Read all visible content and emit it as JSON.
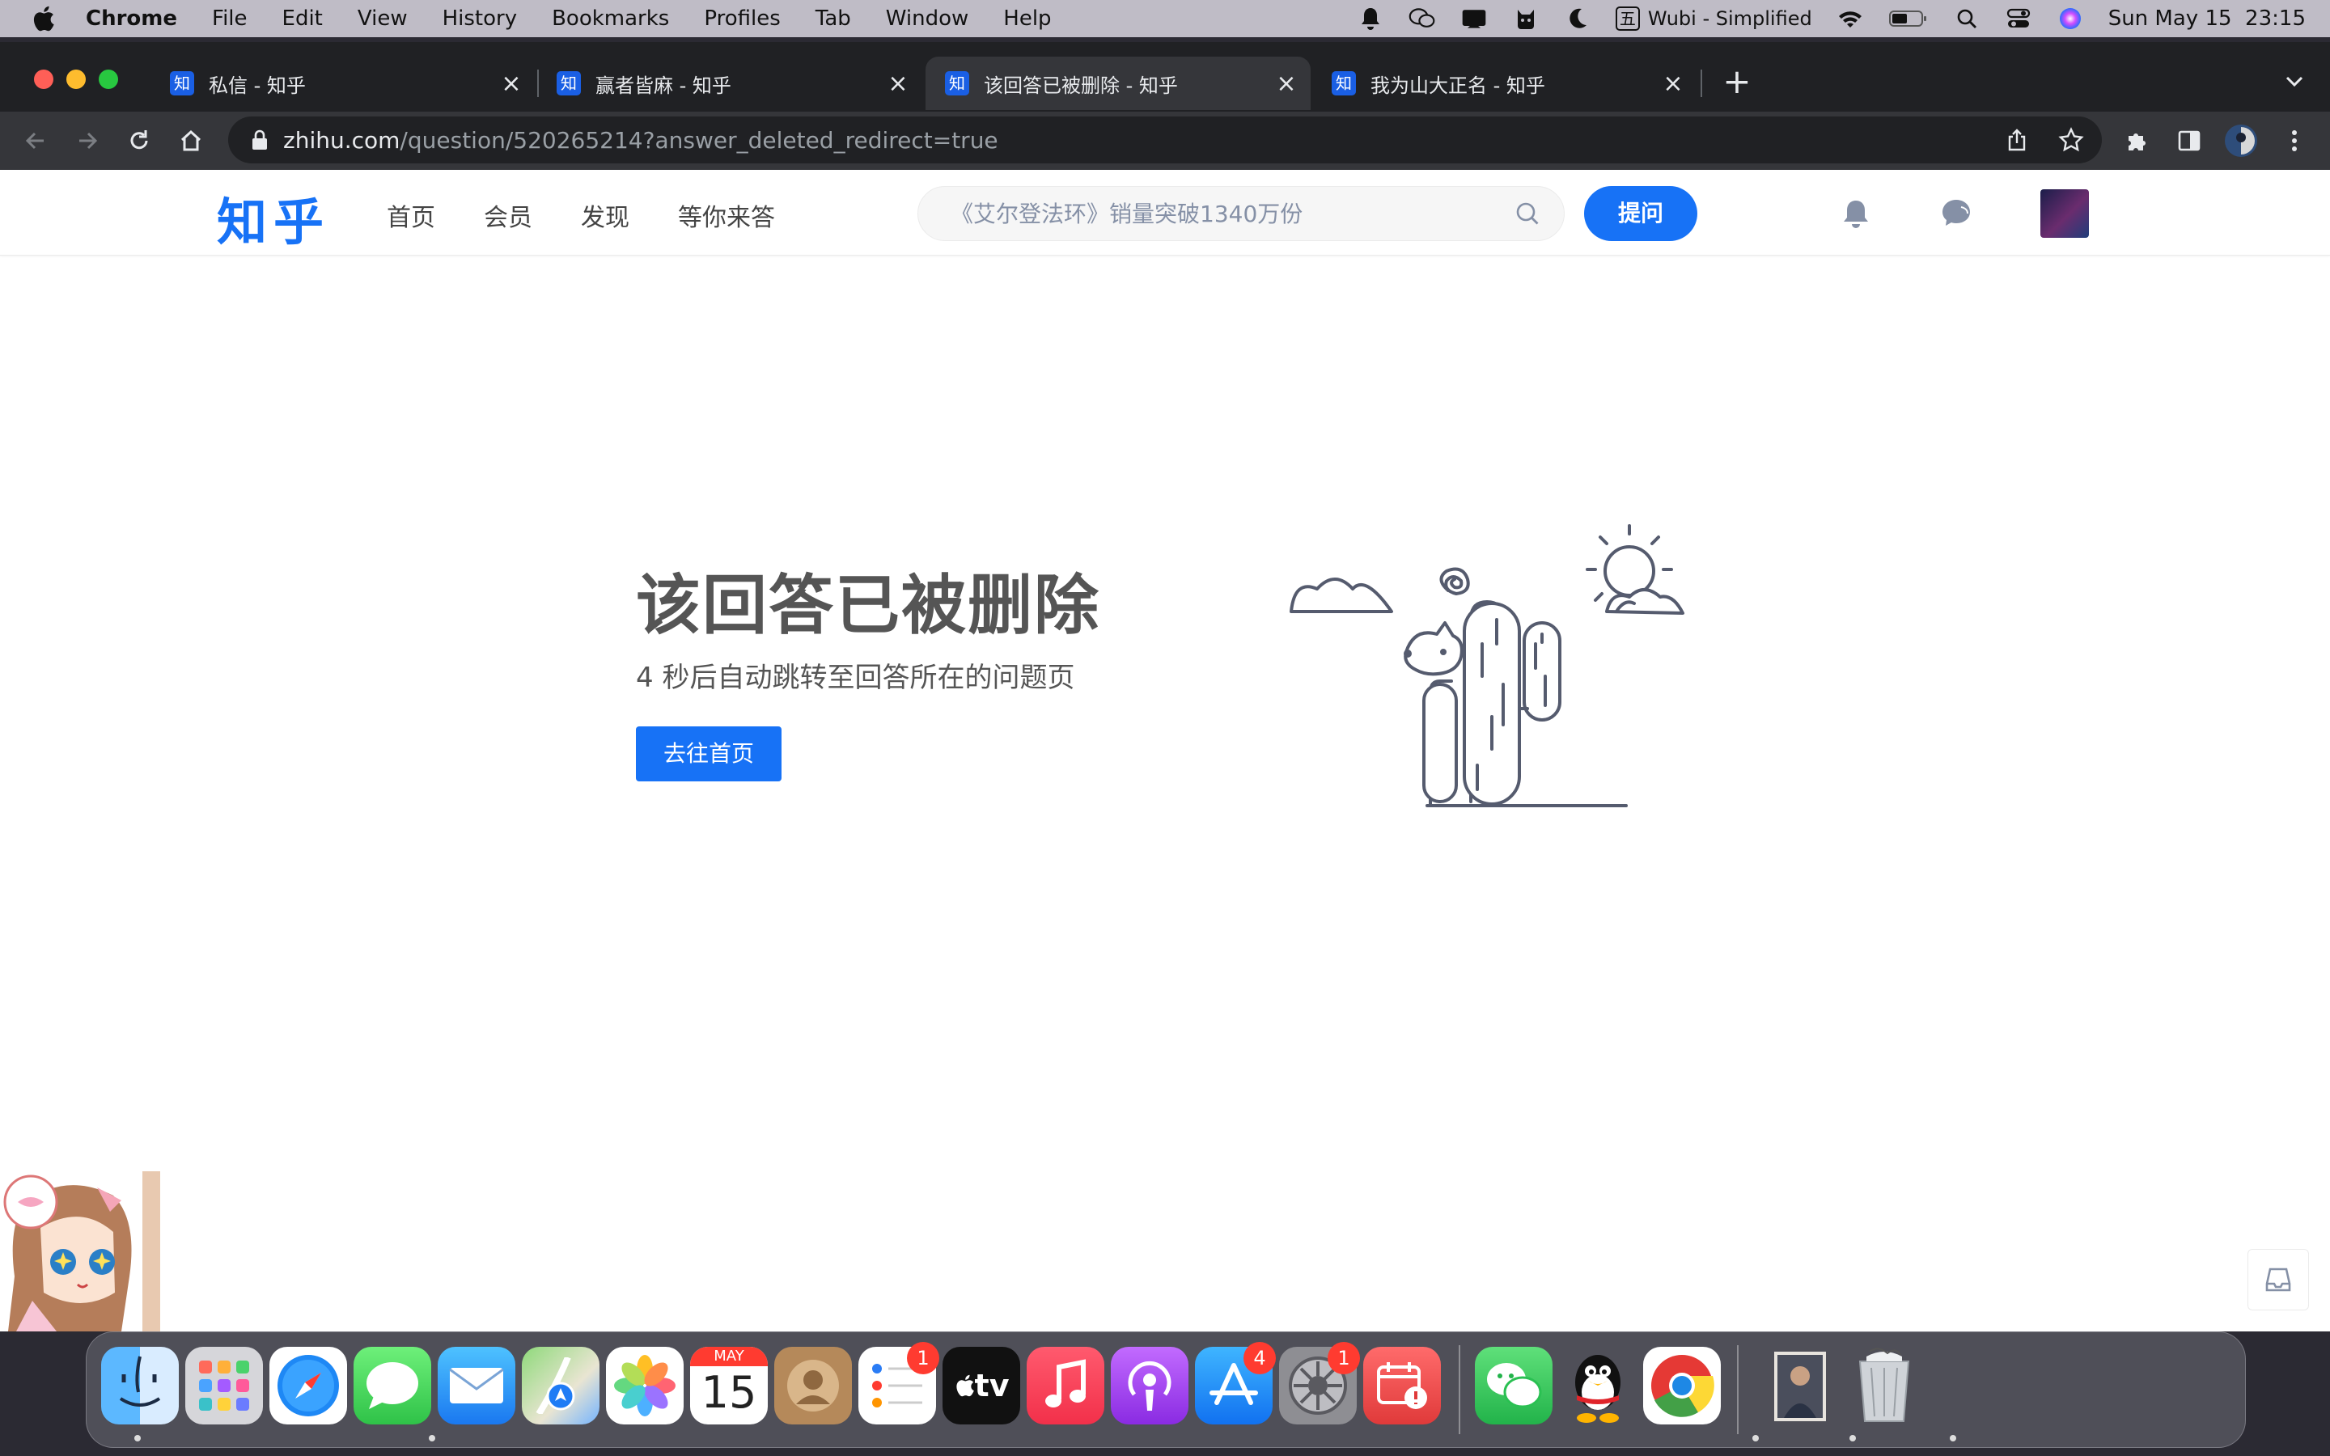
{
  "menubar": {
    "app_name": "Chrome",
    "menus": [
      "File",
      "Edit",
      "View",
      "History",
      "Bookmarks",
      "Profiles",
      "Tab",
      "Window",
      "Help"
    ],
    "input_method": "Wubi - Simplified",
    "input_method_glyph": "五",
    "datetime": "Sun May 15  23:15"
  },
  "browser": {
    "tabs": [
      {
        "favicon": "知",
        "title": "私信 - 知乎",
        "active": false
      },
      {
        "favicon": "知",
        "title": "赢者皆麻 - 知乎",
        "active": false
      },
      {
        "favicon": "知",
        "title": "该回答已被删除 - 知乎",
        "active": true
      },
      {
        "favicon": "知",
        "title": "我为山大正名 - 知乎",
        "active": false
      }
    ],
    "new_tab_label": "+",
    "url_domain": "zhihu.com",
    "url_path": "/question/520265214?answer_deleted_redirect=true"
  },
  "zhihu": {
    "logo": "知乎",
    "nav": [
      "首页",
      "会员",
      "发现",
      "等你来答"
    ],
    "search_placeholder": "《艾尔登法环》销量突破1340万份",
    "ask_button": "提问",
    "error_title": "该回答已被删除",
    "error_subtitle": "4 秒后自动跳转至回答所在的问题页",
    "home_button": "去往首页"
  },
  "dock": {
    "apps": [
      {
        "name": "Finder",
        "badge": null
      },
      {
        "name": "Launchpad",
        "badge": null
      },
      {
        "name": "Safari",
        "badge": null
      },
      {
        "name": "Messages",
        "badge": null
      },
      {
        "name": "Mail",
        "badge": null
      },
      {
        "name": "Maps",
        "badge": null
      },
      {
        "name": "Photos",
        "badge": null
      },
      {
        "name": "Calendar",
        "badge": null,
        "month": "MAY",
        "day": "15"
      },
      {
        "name": "Contacts",
        "badge": null
      },
      {
        "name": "Reminders",
        "badge": "1"
      },
      {
        "name": "Apple TV",
        "badge": null,
        "label": "tv"
      },
      {
        "name": "Music",
        "badge": null
      },
      {
        "name": "Podcasts",
        "badge": null
      },
      {
        "name": "App Store",
        "badge": "4"
      },
      {
        "name": "System Preferences",
        "badge": "1"
      },
      {
        "name": "Calendar Alert",
        "badge": null
      },
      {
        "name": "WeChat",
        "badge": null
      },
      {
        "name": "QQ",
        "badge": null
      },
      {
        "name": "Chrome",
        "badge": null
      }
    ]
  },
  "colors": {
    "zhihu_blue": "#1772f6",
    "badge_red": "#ff3b30",
    "tab_favicon": "#1a5fe4"
  }
}
